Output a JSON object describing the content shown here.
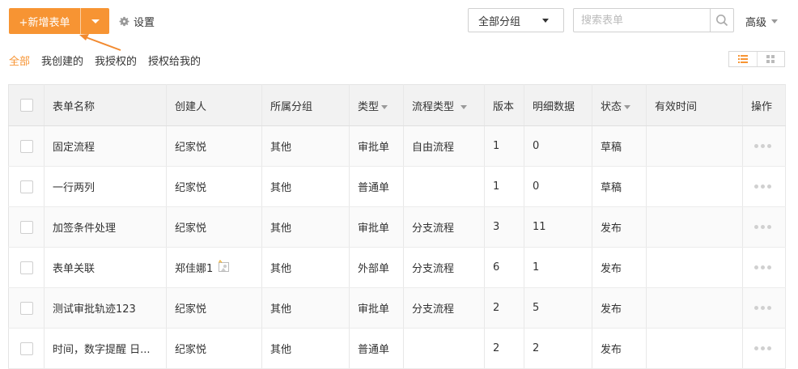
{
  "toolbar": {
    "add_label": "+新增表单",
    "settings_label": "设置",
    "group_select_value": "全部分组",
    "search_placeholder": "搜索表单",
    "advanced_label": "高级",
    "accent": "#f79433"
  },
  "filters": [
    {
      "label": "全部",
      "active": true
    },
    {
      "label": "我创建的",
      "active": false
    },
    {
      "label": "我授权的",
      "active": false
    },
    {
      "label": "授权给我的",
      "active": false
    }
  ],
  "table": {
    "headers": {
      "name": "表单名称",
      "creator": "创建人",
      "group": "所属分组",
      "type": "类型",
      "flow_type": "流程类型",
      "version": "版本",
      "detail": "明细数据",
      "status": "状态",
      "valid_time": "有效时间",
      "actions": "操作"
    },
    "rows": [
      {
        "name": "固定流程",
        "creator": "纪家悦",
        "group": "其他",
        "type": "审批单",
        "flow_type": "自由流程",
        "version": "1",
        "detail": "0",
        "status": "草稿",
        "valid_time": ""
      },
      {
        "name": "一行两列",
        "creator": "纪家悦",
        "group": "其他",
        "type": "普通单",
        "flow_type": "",
        "version": "1",
        "detail": "0",
        "status": "草稿",
        "valid_time": ""
      },
      {
        "name": "加签条件处理",
        "creator": "纪家悦",
        "group": "其他",
        "type": "审批单",
        "flow_type": "分支流程",
        "version": "3",
        "detail": "11",
        "status": "发布",
        "valid_time": ""
      },
      {
        "name": "表单关联",
        "creator": "郑佳娜1",
        "group": "其他",
        "type": "外部单",
        "flow_type": "分支流程",
        "version": "6",
        "detail": "1",
        "status": "发布",
        "valid_time": ""
      },
      {
        "name": "测试审批轨迹123",
        "creator": "纪家悦",
        "group": "其他",
        "type": "审批单",
        "flow_type": "分支流程",
        "version": "2",
        "detail": "5",
        "status": "发布",
        "valid_time": ""
      },
      {
        "name": "时间，数字提醒 日...",
        "creator": "纪家悦",
        "group": "其他",
        "type": "普通单",
        "flow_type": "",
        "version": "2",
        "detail": "2",
        "status": "发布",
        "valid_time": ""
      }
    ]
  }
}
